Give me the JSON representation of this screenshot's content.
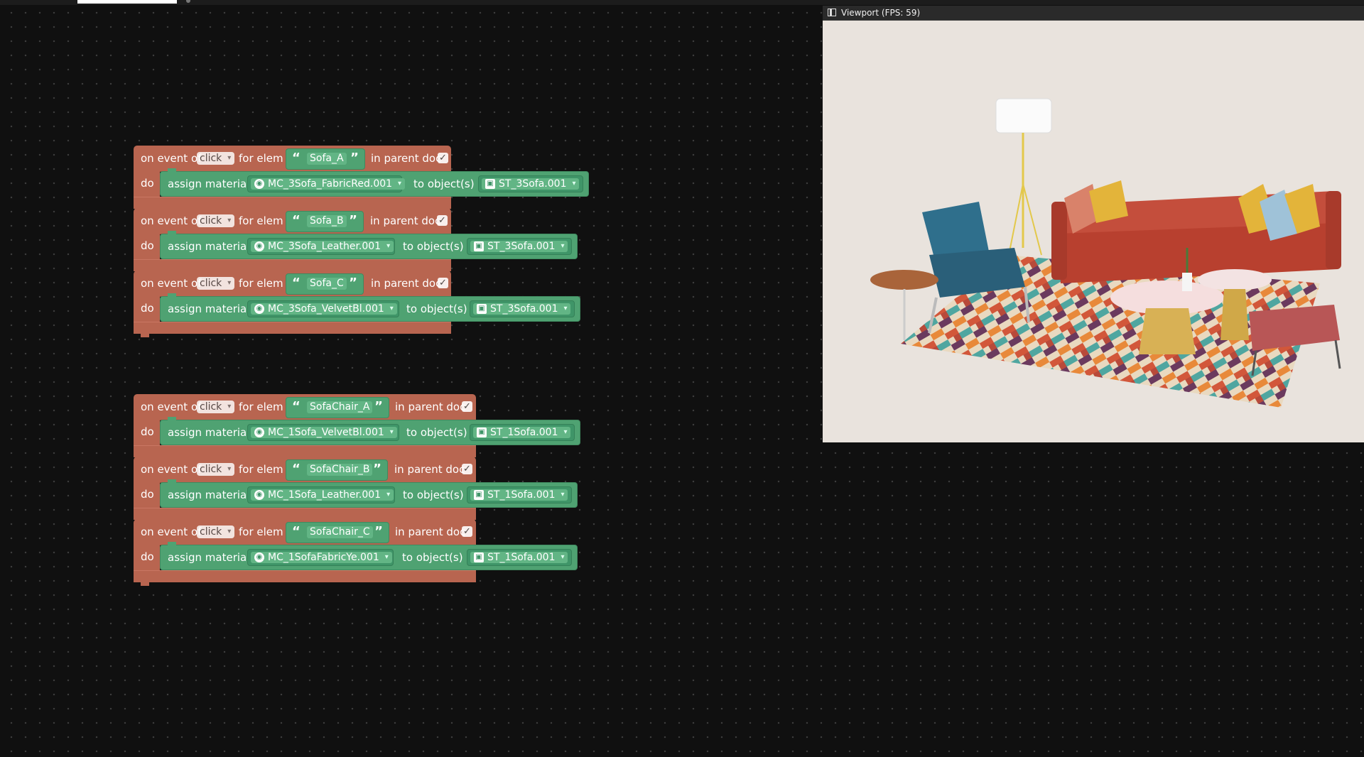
{
  "viewport": {
    "title": "Viewport (FPS: 59)"
  },
  "labels": {
    "on_event_of": "on event of",
    "for_elem": "for elem",
    "in_parent_doc": "in parent doc",
    "do": "do",
    "assign_material": "assign material",
    "to_objects": "to object(s)"
  },
  "events": [
    {
      "event": "click",
      "element": "Sofa_A",
      "parent_doc": true,
      "material": "MC_3Sofa_FabricRed.001",
      "object": "ST_3Sofa.001"
    },
    {
      "event": "click",
      "element": "Sofa_B",
      "parent_doc": true,
      "material": "MC_3Sofa_Leather.001",
      "object": "ST_3Sofa.001"
    },
    {
      "event": "click",
      "element": "Sofa_C",
      "parent_doc": true,
      "material": "MC_3Sofa_VelvetBl.001",
      "object": "ST_3Sofa.001"
    },
    {
      "event": "click",
      "element": "SofaChair_A",
      "parent_doc": true,
      "material": "MC_1Sofa_VelvetBl.001",
      "object": "ST_1Sofa.001"
    },
    {
      "event": "click",
      "element": "SofaChair_B",
      "parent_doc": true,
      "material": "MC_1Sofa_Leather.001",
      "object": "ST_1Sofa.001"
    },
    {
      "event": "click",
      "element": "SofaChair_C",
      "parent_doc": true,
      "material": "MC_1SofaFabricYe.001",
      "object": "ST_1Sofa.001"
    }
  ],
  "colors": {
    "event_block": "#b86550",
    "action_block": "#4fa272",
    "canvas": "#101010"
  },
  "icons": {
    "material": "globe-icon",
    "object": "cube-icon",
    "viewport": "panel-icon"
  }
}
